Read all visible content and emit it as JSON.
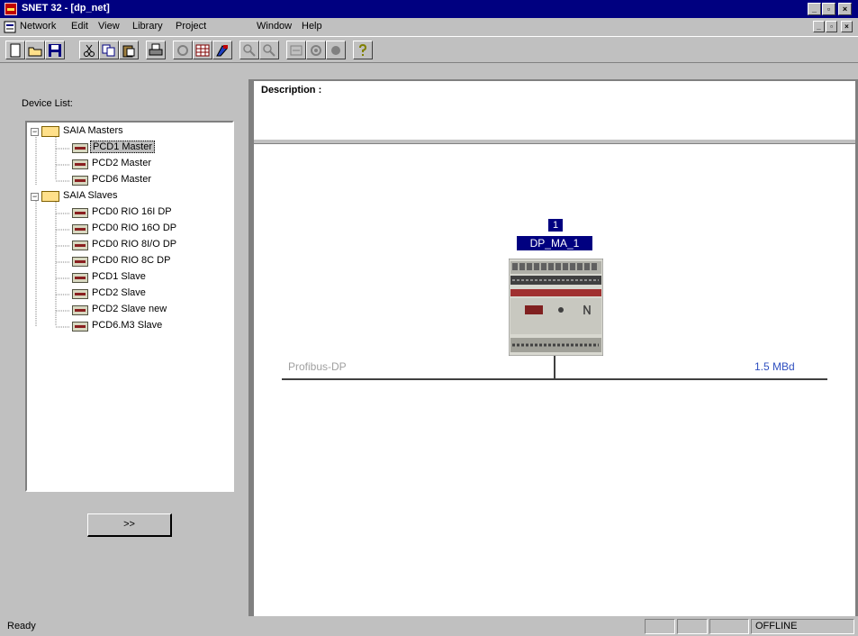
{
  "window": {
    "title": "SNET 32 - [dp_net]",
    "min_glyph": "_",
    "max_glyph": "▫",
    "close_glyph": "×"
  },
  "menu": {
    "items": [
      "Network",
      "Edit",
      "View",
      "Library",
      "Project",
      "Window",
      "Help"
    ]
  },
  "toolbar": {
    "buttons": [
      "new-icon",
      "open-icon",
      "save-icon",
      "cut-icon",
      "copy-icon",
      "paste-icon",
      "print-icon",
      "refresh-icon",
      "grid-icon",
      "paint-icon",
      "zoom-in-icon",
      "zoom-out-icon",
      "connect-icon",
      "settings-icon",
      "record-icon",
      "help-icon"
    ]
  },
  "device_list": {
    "label": "Device List:",
    "groups": [
      {
        "name": "SAIA Masters",
        "items": [
          "PCD1 Master",
          "PCD2 Master",
          "PCD6 Master"
        ]
      },
      {
        "name": "SAIA Slaves",
        "items": [
          "PCD0 RIO 16I DP",
          "PCD0 RIO 16O DP",
          "PCD0 RIO 8I/O DP",
          "PCD0 RIO 8C DP",
          "PCD1 Slave",
          "PCD2 Slave",
          "PCD2 Slave new",
          "PCD6.M3 Slave"
        ]
      }
    ],
    "selected": "PCD1 Master",
    "transfer_button": ">>"
  },
  "description": {
    "label": "Description :"
  },
  "network": {
    "node_number": "1",
    "node_name": "DP_MA_1",
    "bus_name": "Profibus-DP",
    "bus_speed": "1.5 MBd"
  },
  "status": {
    "text": "Ready",
    "mode": "OFFLINE"
  },
  "colors": {
    "title_bg": "#000080",
    "face": "#c0c0c0",
    "node_bg": "#000080",
    "speed": "#3050c0"
  }
}
